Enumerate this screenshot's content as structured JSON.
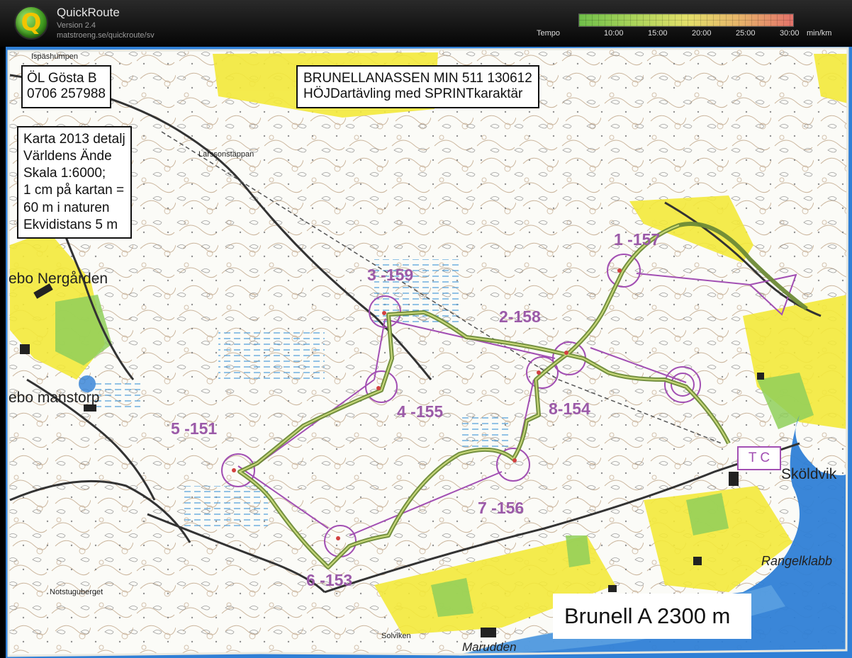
{
  "app": {
    "name": "QuickRoute",
    "version": "Version 2.4",
    "url": "matstroeng.se/quickroute/sv"
  },
  "tempo": {
    "label": "Tempo",
    "ticks": [
      "10:00",
      "15:00",
      "20:00",
      "25:00",
      "30:00"
    ],
    "unit": "min/km",
    "colors": [
      "#6fbf4a",
      "#a9d35a",
      "#e3e06a",
      "#e7b46a",
      "#e3726a"
    ]
  },
  "map": {
    "club_box": [
      "ÖL Gösta B",
      "0706 257988"
    ],
    "title_box": [
      "BRUNELLANASSEN MIN 511 130612",
      "HÖJDartävling med SPRINTkaraktär"
    ],
    "info_box": [
      "Karta 2013 detalj",
      "Världens Ände",
      "Skala 1:6000;",
      "1 cm på kartan =",
      "60 m i naturen",
      "Ekvidistans 5 m"
    ],
    "course_box": "Brunell A 2300 m",
    "finish_label": "T C",
    "controls": [
      "1 -157",
      "2-158",
      "3 -159",
      "4 -155",
      "5 -151",
      "6 -153",
      "7 -156",
      "8-154"
    ],
    "places": {
      "ispashumpen": "Ispäshumpen",
      "larssonstappan": "Larssonstäppan",
      "nergarden": "ebo Nergården",
      "manstorp": "ebo manstorp",
      "notstugubergen": "Notstuguberget",
      "skoldvik": "Sköldvik",
      "rangelklabb": "Rangelklabb",
      "solviken": "Solviken",
      "marudden": "Marudden"
    },
    "colors": {
      "course": "#a24fb3",
      "route": "#6d8a36",
      "open_land": "#f3e93a",
      "water": "#2f7fd6"
    }
  }
}
